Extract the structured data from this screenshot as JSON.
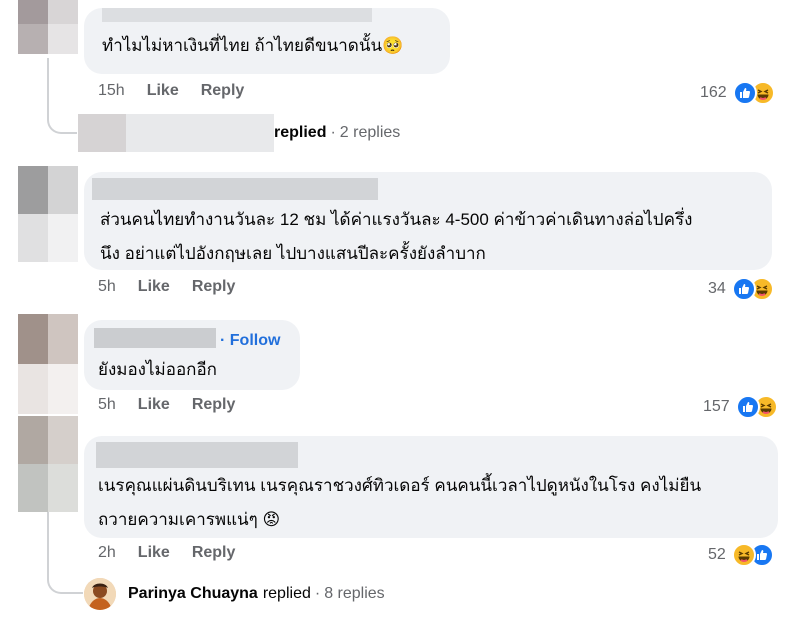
{
  "comments": [
    {
      "text_lines": [
        "ทำไมไม่หาเงินที่ไทย ถ้าไทยดีขนาดนั้น🥺"
      ],
      "time": "15h",
      "like_label": "Like",
      "reply_label": "Reply",
      "reaction_count": "162",
      "reaction_icons": [
        "like-icon",
        "haha-icon"
      ]
    },
    {
      "text_lines": [
        "ส่วนคนไทยทำงานวันละ 12 ชม ได้ค่าแรงวันละ 4-500 ค่าข้าวค่าเดินทางล่อไปครึ่ง",
        "นึง อย่าแต่ไปอังกฤษเลย ไปบางแสนปีละครั้งยังลำบาก"
      ],
      "time": "5h",
      "like_label": "Like",
      "reply_label": "Reply",
      "reaction_count": "34",
      "reaction_icons": [
        "like-icon",
        "haha-icon"
      ]
    },
    {
      "follow_label": "· Follow",
      "text_lines": [
        "ยังมองไม่ออกอีก"
      ],
      "time": "5h",
      "like_label": "Like",
      "reply_label": "Reply",
      "reaction_count": "157",
      "reaction_icons": [
        "like-icon",
        "haha-icon"
      ]
    },
    {
      "text_lines": [
        "เนรคุณแผ่นดินบริเทน เนรคุณราชวงศ์ทิวเดอร์ คนคนนี้เวลาไปดูหนังในโรง คงไม่ยืน",
        "ถวายความเคารพแน่ๆ 😡"
      ],
      "time": "2h",
      "like_label": "Like",
      "reply_label": "Reply",
      "reaction_count": "52",
      "reaction_icons": [
        "haha-icon",
        "like-icon"
      ]
    }
  ],
  "reply_summaries": [
    {
      "name": "",
      "name_suffix": "n",
      "replied": "replied",
      "count": "2 replies"
    },
    {
      "name": "Parinya Chuayna",
      "replied": "replied",
      "count": "8 replies"
    }
  ],
  "colors": {
    "bubble": "#f0f2f5",
    "meta_text": "#65676b",
    "like_blue": "#1877f2",
    "haha_yellow": "#f7b928",
    "link_blue": "#216fdb"
  }
}
